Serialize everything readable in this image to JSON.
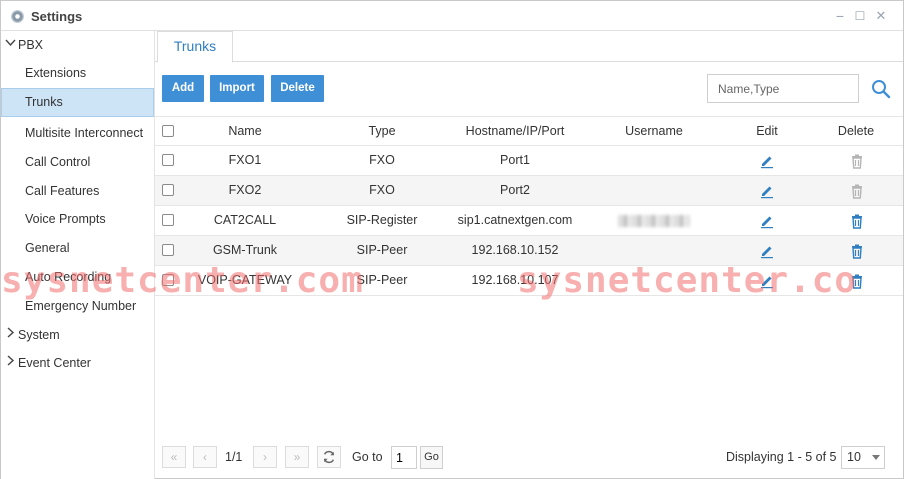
{
  "window": {
    "title": "Settings",
    "controls": {
      "minimize": "−",
      "maximize": "☐",
      "close": "✕"
    }
  },
  "sidebar": {
    "groups": [
      {
        "label": "PBX",
        "expanded": true,
        "items": [
          {
            "label": "Extensions"
          },
          {
            "label": "Trunks",
            "active": true
          },
          {
            "label": "Multisite Interconnect"
          },
          {
            "label": "Call Control"
          },
          {
            "label": "Call Features"
          },
          {
            "label": "Voice Prompts"
          },
          {
            "label": "General"
          },
          {
            "label": "Auto Recording"
          },
          {
            "label": "Emergency Number"
          }
        ]
      },
      {
        "label": "System",
        "expanded": false
      },
      {
        "label": "Event Center",
        "expanded": false
      }
    ]
  },
  "tabs": [
    {
      "label": "Trunks",
      "active": true
    }
  ],
  "toolbar": {
    "add_label": "Add",
    "import_label": "Import",
    "delete_label": "Delete",
    "search_placeholder": "Name,Type",
    "search_value": ""
  },
  "table": {
    "columns": [
      "Name",
      "Type",
      "Hostname/IP/Port",
      "Username",
      "Edit",
      "Delete"
    ],
    "rows": [
      {
        "name": "FXO1",
        "type": "FXO",
        "host": "Port1",
        "username": "",
        "delete_enabled": false
      },
      {
        "name": "FXO2",
        "type": "FXO",
        "host": "Port2",
        "username": "",
        "delete_enabled": false
      },
      {
        "name": "CAT2CALL",
        "type": "SIP-Register",
        "host": "sip1.catnextgen.com",
        "username": "",
        "username_redacted": true,
        "delete_enabled": true
      },
      {
        "name": "GSM-Trunk",
        "type": "SIP-Peer",
        "host": "192.168.10.152",
        "username": "",
        "delete_enabled": true
      },
      {
        "name": "VOIP-GATEWAY",
        "type": "SIP-Peer",
        "host": "192.168.10.107",
        "username": "",
        "delete_enabled": true
      }
    ]
  },
  "pager": {
    "page_info": "1/1",
    "goto_label": "Go to",
    "goto_value": "1",
    "go_label": "Go",
    "displaying": "Displaying 1 - 5 of 5",
    "page_size": "10"
  },
  "watermark": {
    "left": "sysnetcenter.com",
    "right": "sysnetcenter.co"
  },
  "colors": {
    "accent": "#3f8fd6",
    "tab_text": "#2f7fc1",
    "active_row": "#cde4f7",
    "watermark": "#f06e6e",
    "icon_blue": "#2f7fc1",
    "icon_disabled": "#b5b5b5"
  }
}
